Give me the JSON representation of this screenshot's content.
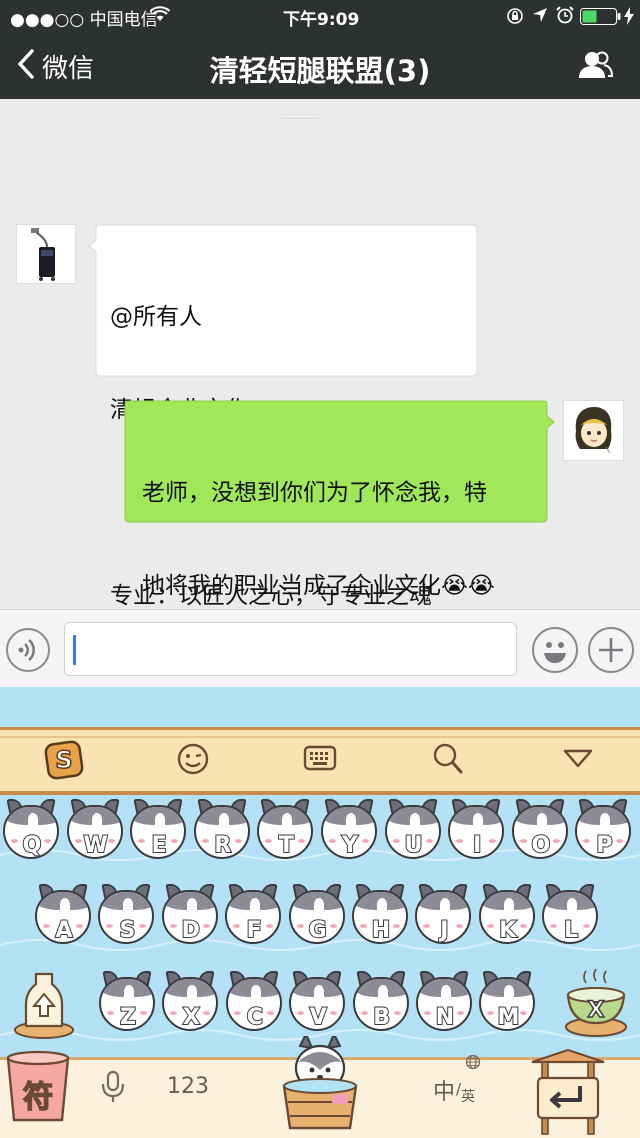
{
  "status_bar": {
    "carrier": "●●●○○ 中国电信",
    "wifi_icon": "wifi-icon",
    "time": "下午9:09",
    "right_icons": [
      "lock-rotation-icon",
      "location-icon",
      "alarm-icon",
      "battery-icon",
      "charging-icon"
    ]
  },
  "nav": {
    "back_label": "微信",
    "title": "清轻短腿联盟(3)",
    "members_icon": "members-icon"
  },
  "messages": [
    {
      "side": "left",
      "lines": [
        "@所有人",
        "清轻企业文化：",
        "",
        "专业：以匠人之心，守专业之魂"
      ]
    },
    {
      "side": "right",
      "lines": [
        "老师，没想到你们为了怀念我，特",
        "地将我的职业当成了企业文化😭😭",
        "😭"
      ]
    }
  ],
  "input_bar": {
    "voice_icon": "voice-icon",
    "emoji_icon": "emoji-icon",
    "plus_icon": "plus-icon",
    "value": ""
  },
  "keyboard": {
    "toolbar_icons": [
      "sogou-logo-icon",
      "smiley-icon",
      "keyboard-icon",
      "search-icon",
      "collapse-triangle-icon"
    ],
    "row1": [
      "Q",
      "W",
      "E",
      "R",
      "T",
      "Y",
      "U",
      "I",
      "O",
      "P"
    ],
    "row2": [
      "A",
      "S",
      "D",
      "F",
      "G",
      "H",
      "J",
      "K",
      "L"
    ],
    "row3": [
      "Z",
      "X",
      "C",
      "V",
      "B",
      "N",
      "M"
    ],
    "shift_icon": "shift-bottle-icon",
    "delete_icon": "delete-bowl-icon",
    "symbol_label": "符",
    "mic_icon": "mic-icon",
    "num_label": "123",
    "space_icon": "husky-tub-icon",
    "lang_main": "中",
    "lang_sep": "/",
    "lang_alt": "英",
    "globe_icon": "globe-icon",
    "enter_icon": "enter-arrow-icon"
  },
  "colors": {
    "nav_bg": "#2e3132",
    "chat_bg": "#ebebeb",
    "bubble_right": "#a0e75a",
    "keyboard_bg": "#b3e2f5",
    "keyboard_toolbar": "#f8e3b3"
  }
}
